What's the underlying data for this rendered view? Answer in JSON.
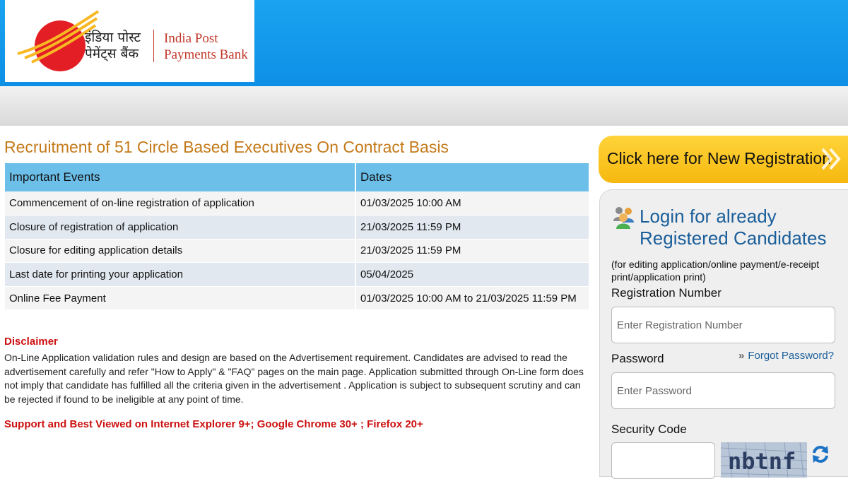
{
  "header": {
    "logo_hindi_line1": "इंडिया पोस्ट",
    "logo_hindi_line2": "पेमेंट्स बैंक",
    "logo_en_line1": "India Post",
    "logo_en_line2": "Payments Bank",
    "brand_color": "#e31e24",
    "accent_color": "#f7b824"
  },
  "main": {
    "title": "Recruitment of 51 Circle Based Executives On Contract Basis",
    "table": {
      "headers": [
        "Important Events",
        "Dates"
      ],
      "rows": [
        [
          "Commencement of on-line registration of application",
          "01/03/2025 10:00 AM"
        ],
        [
          "Closure of registration of application",
          "21/03/2025 11:59 PM"
        ],
        [
          "Closure for editing application details",
          "21/03/2025 11:59 PM"
        ],
        [
          "Last date for printing your application",
          "05/04/2025"
        ],
        [
          "Online Fee Payment",
          "01/03/2025 10:00 AM to 21/03/2025 11:59 PM"
        ]
      ]
    },
    "disclaimer_heading": "Disclaimer",
    "disclaimer_text": "On-Line Application validation rules and design are based on the Advertisement requirement. Candidates are advised to read the advertisement carefully and refer \"How to Apply\" & \"FAQ\" pages on the main page. Application submitted through On-Line form does not imply that candidate has fulfilled all the criteria given in the advertisement . Application is subject to subsequent scrutiny and can be rejected if found to be ineligible at any point of time.",
    "support_text": "Support and Best Viewed on Internet Explorer 9+; Google Chrome 30+ ; Firefox 20+"
  },
  "sidebar": {
    "new_registration_label": "Click here for New Registration",
    "login_title_line1": "Login for already",
    "login_title_line2": "Registered Candidates",
    "login_subtitle": "(for editing application/online payment/e-receipt print/application print)",
    "registration_label": "Registration Number",
    "registration_placeholder": "Enter Registration Number",
    "password_label": "Password",
    "password_placeholder": "Enter Password",
    "forgot_password": "Forgot Password?",
    "security_code_label": "Security Code",
    "captcha_text": "nbtnf",
    "icons": [
      "users-icon",
      "chevron-right-icon",
      "refresh-icon"
    ]
  }
}
